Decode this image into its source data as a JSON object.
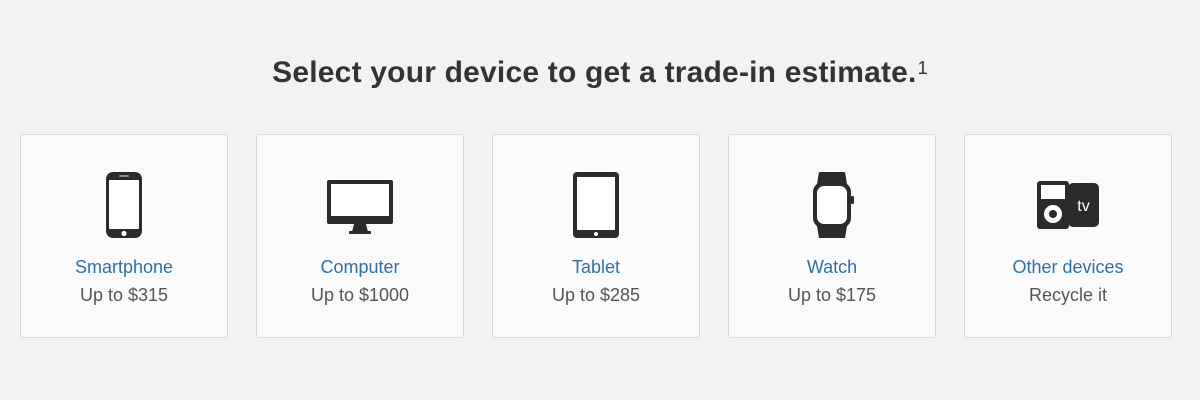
{
  "headline": {
    "text": "Select your device to get a trade-in estimate.",
    "footnote": "1"
  },
  "cards": [
    {
      "icon": "smartphone-icon",
      "label": "Smartphone",
      "value": "Up to $315"
    },
    {
      "icon": "computer-icon",
      "label": "Computer",
      "value": "Up to $1000"
    },
    {
      "icon": "tablet-icon",
      "label": "Tablet",
      "value": "Up to $285"
    },
    {
      "icon": "watch-icon",
      "label": "Watch",
      "value": "Up to $175"
    },
    {
      "icon": "other-devices-icon",
      "label": "Other devices",
      "value": "Recycle it",
      "icon_text": "tv"
    }
  ],
  "colors": {
    "background": "#f2f2f2",
    "card_background": "#fafafa",
    "link": "#2f6fa8",
    "icon": "#2b2b2b"
  }
}
